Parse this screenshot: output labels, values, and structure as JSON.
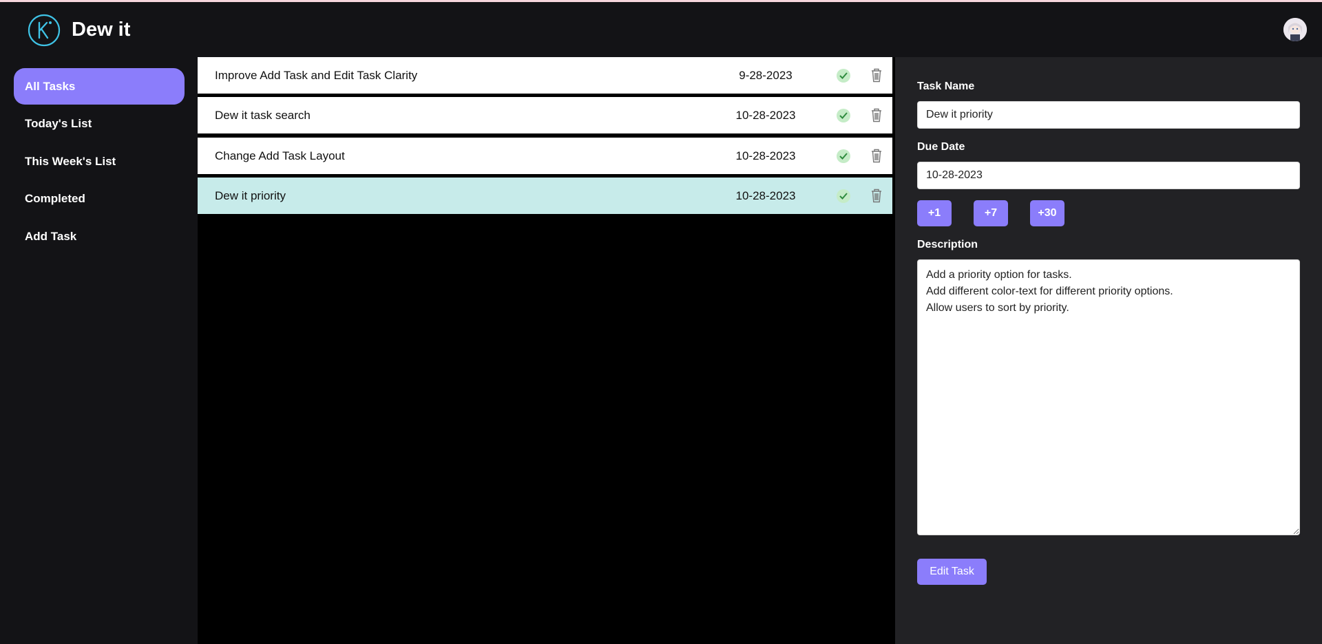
{
  "app": {
    "title": "Dew it",
    "logo_icon": "k-logo-icon",
    "avatar_icon": "user-avatar-icon"
  },
  "colors": {
    "accent": "#8b7dfb",
    "selected_row": "#c7ebea",
    "check": "#4caf50"
  },
  "sidebar": {
    "items": [
      {
        "label": "All Tasks",
        "active": true
      },
      {
        "label": "Today's List",
        "active": false
      },
      {
        "label": "This Week's List",
        "active": false
      },
      {
        "label": "Completed",
        "active": false
      },
      {
        "label": "Add Task",
        "active": false
      }
    ]
  },
  "tasks": [
    {
      "name": "Improve Add Task and Edit Task Clarity",
      "date": "9-28-2023",
      "selected": false
    },
    {
      "name": "Dew it task search",
      "date": "10-28-2023",
      "selected": false
    },
    {
      "name": "Change Add Task Layout",
      "date": "10-28-2023",
      "selected": false
    },
    {
      "name": "Dew it priority",
      "date": "10-28-2023",
      "selected": true
    }
  ],
  "detail": {
    "task_name_label": "Task Name",
    "task_name_value": "Dew it priority",
    "due_date_label": "Due Date",
    "due_date_value": "10-28-2023",
    "quick_buttons": [
      "+1",
      "+7",
      "+30"
    ],
    "description_label": "Description",
    "description_value": "Add a priority option for tasks.\nAdd different color-text for different priority options.\nAllow users to sort by priority.",
    "submit_label": "Edit Task"
  }
}
